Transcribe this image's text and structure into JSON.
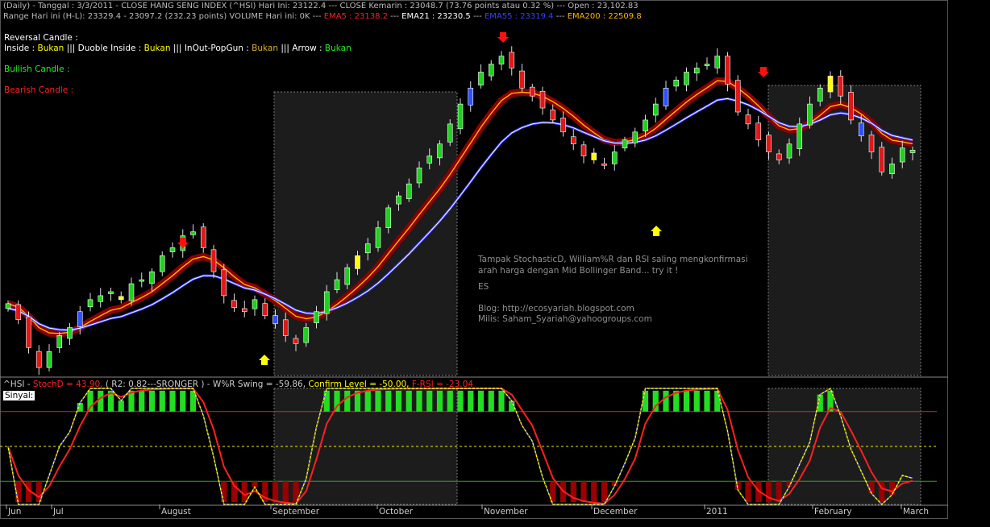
{
  "colors": {
    "bg": "#000000",
    "up": "#1fd01f",
    "down": "#e01818",
    "doji": "#3050ff",
    "inside": "#ffff00",
    "ema5": "#ff2020",
    "ema21": "#ffffff",
    "ema55": "#3b40ff",
    "ema200": "#ffb400",
    "stoch": "#ff2020",
    "wr": "#ffffff",
    "rsi": "#ff0000",
    "confirm": "#ffff00",
    "zoneTop": "#22dd22",
    "zoneBottom": "#990000",
    "shade": "#1c1c1c"
  },
  "header": {
    "line1": "(Daily) - Tanggal : 3/3/2011  - CLOSE HANG SENG INDEX  (^HSI) Hari Ini: 23122.4 --- CLOSE Kemarin :  23048.7 (73.76 points atau 0.32 %) --- Open : 23,102.83",
    "line2_a": "Range Hari ini (H-L):  23329.4 - 23097.2 (232.23 points) VOLUME Hari ini:  0K --- ",
    "ema5_label": "EMA5 : 23138.2",
    "ema21_label": "EMA21 : 23230.5",
    "ema55_label": "EMA55 : 23319.4",
    "ema200_label": "EMA200 : 22509.8",
    "sep": " --- "
  },
  "signals": {
    "reversal": "Reversal Candle :",
    "inside_label": "Inside :",
    "inside_val": "Bukan",
    "duoble_label": "Duoble Inside :",
    "duoble_val": "Bukan",
    "inout_label": "InOut-PopGun :",
    "inout_val": "Bukan",
    "arrow_label": "Arrow :",
    "arrow_val": "Bukan",
    "pipes": "|||",
    "bullish": "Bullish Candle :",
    "bearish": "Bearish Candle :"
  },
  "note": {
    "line1": "Tampak StochasticD, William%R dan RSI saling mengkonfirmasi",
    "line2": "arah harga dengan Mid Bollinger Band... try it !",
    "line3": "ES",
    "line4": "Blog:  http://ecosyariah.blogspot.com",
    "line5": "Milis: Saham_Syariah@yahoogroups.com"
  },
  "indicator_header": {
    "sym": "^HSI - ",
    "stoch": "StochD = 43.90,",
    "r2": "  ( R2: 0.82---SRONGER )",
    "wr": " - W%R Swing = -59.86,",
    "confirm": " Confirm Level = -50.00,",
    "rsi": " F-RSI = -23.04",
    "sinyal": "Sinyal:"
  },
  "chart_data": {
    "type": "candlestick",
    "title": "CLOSE HANG SENG INDEX (^HSI)",
    "months": [
      "Jun",
      "Jul",
      "August",
      "September",
      "October",
      "November",
      "December",
      "2011",
      "February",
      "March"
    ],
    "closes": [
      21200,
      21000,
      20650,
      20400,
      20600,
      20800,
      20900,
      21100,
      21250,
      21300,
      21350,
      21250,
      21450,
      21500,
      21600,
      21800,
      21900,
      22050,
      22100,
      21900,
      21600,
      21300,
      21150,
      21100,
      21250,
      21050,
      20950,
      20800,
      20700,
      20900,
      21100,
      21350,
      21500,
      21650,
      21800,
      21950,
      22150,
      22400,
      22550,
      22700,
      22900,
      23050,
      23200,
      23450,
      23700,
      23900,
      24100,
      24200,
      24300,
      24150,
      23900,
      23800,
      23650,
      23500,
      23350,
      23200,
      23050,
      23000,
      22950,
      23100,
      23250,
      23350,
      23500,
      23700,
      23900,
      24000,
      24100,
      24150,
      24200,
      24300,
      23950,
      23600,
      23450,
      23250,
      23100,
      23000,
      23200,
      23450,
      23700,
      23900,
      24050,
      23800,
      23500,
      23300,
      23100,
      22850,
      22950,
      23150,
      23122
    ],
    "ema21_end": 23230.5,
    "ema55_end": 23319.4,
    "indicator": {
      "stochD": 43.9,
      "r2": 0.82,
      "wr_swing": -59.86,
      "confirm_level": -50.0,
      "f_rsi": -23.04,
      "upper_level": 80,
      "lower_level": 20,
      "mid_level": 50
    }
  }
}
